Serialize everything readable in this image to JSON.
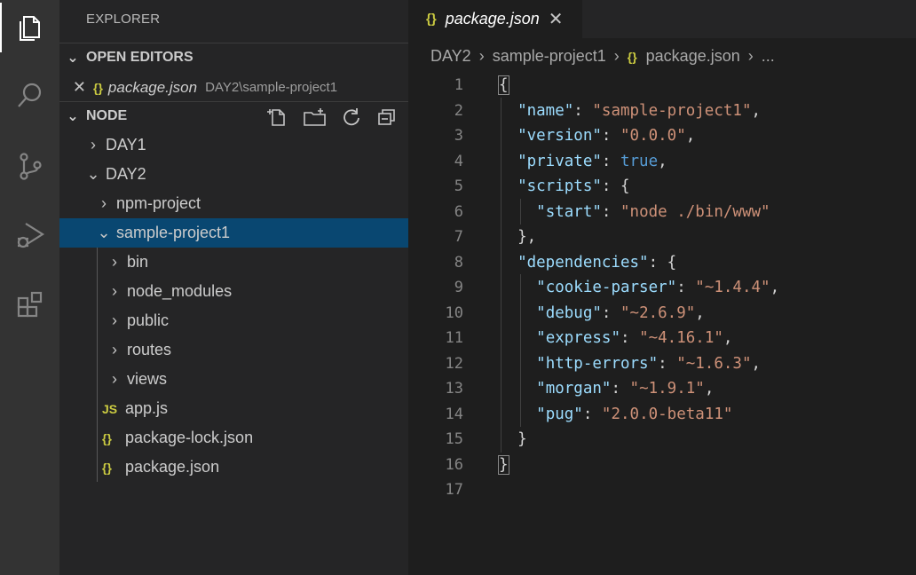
{
  "activity_bar": {
    "items": [
      {
        "name": "explorer",
        "icon": "files-icon",
        "active": true
      },
      {
        "name": "search",
        "icon": "search-icon"
      },
      {
        "name": "source-control",
        "icon": "source-control-icon"
      },
      {
        "name": "run-debug",
        "icon": "run-debug-icon"
      },
      {
        "name": "extensions",
        "icon": "extensions-icon"
      }
    ]
  },
  "sidebar": {
    "title": "EXPLORER",
    "open_editors": {
      "header": "OPEN EDITORS",
      "items": [
        {
          "close": "✕",
          "icon": "{}",
          "name": "package.json",
          "path": "DAY2\\sample-project1"
        }
      ]
    },
    "workspace": {
      "header": "NODE",
      "actions": [
        "new-file-icon",
        "new-folder-icon",
        "refresh-icon",
        "collapse-all-icon"
      ],
      "tree": [
        {
          "label": "DAY1",
          "chevron": "›",
          "depth": 0
        },
        {
          "label": "DAY2",
          "chevron": "⌄",
          "depth": 0
        },
        {
          "label": "npm-project",
          "chevron": "›",
          "depth": 1
        },
        {
          "label": "sample-project1",
          "chevron": "⌄",
          "depth": 1,
          "selected": true
        },
        {
          "label": "bin",
          "chevron": "›",
          "depth": 2
        },
        {
          "label": "node_modules",
          "chevron": "›",
          "depth": 2
        },
        {
          "label": "public",
          "chevron": "›",
          "depth": 2
        },
        {
          "label": "routes",
          "chevron": "›",
          "depth": 2
        },
        {
          "label": "views",
          "chevron": "›",
          "depth": 2
        },
        {
          "label": "app.js",
          "icon": "JS",
          "depth": 2
        },
        {
          "label": "package-lock.json",
          "icon": "{}",
          "depth": 2
        },
        {
          "label": "package.json",
          "icon": "{}",
          "depth": 2
        }
      ]
    }
  },
  "editor": {
    "tab": {
      "icon": "{}",
      "label": "package.json",
      "close": "✕"
    },
    "breadcrumbs": [
      "DAY2",
      "sample-project1",
      "package.json",
      "..."
    ],
    "breadcrumb_icon": "{}",
    "lines": [
      [
        [
          "p",
          "{"
        ]
      ],
      [
        [
          "p",
          "  "
        ],
        [
          "k",
          "\"name\""
        ],
        [
          "p",
          ": "
        ],
        [
          "s",
          "\"sample-project1\""
        ],
        [
          "p",
          ","
        ]
      ],
      [
        [
          "p",
          "  "
        ],
        [
          "k",
          "\"version\""
        ],
        [
          "p",
          ": "
        ],
        [
          "s",
          "\"0.0.0\""
        ],
        [
          "p",
          ","
        ]
      ],
      [
        [
          "p",
          "  "
        ],
        [
          "k",
          "\"private\""
        ],
        [
          "p",
          ": "
        ],
        [
          "b",
          "true"
        ],
        [
          "p",
          ","
        ]
      ],
      [
        [
          "p",
          "  "
        ],
        [
          "k",
          "\"scripts\""
        ],
        [
          "p",
          ": {"
        ]
      ],
      [
        [
          "p",
          "    "
        ],
        [
          "k",
          "\"start\""
        ],
        [
          "p",
          ": "
        ],
        [
          "s",
          "\"node ./bin/www\""
        ]
      ],
      [
        [
          "p",
          "  },"
        ]
      ],
      [
        [
          "p",
          "  "
        ],
        [
          "k",
          "\"dependencies\""
        ],
        [
          "p",
          ": {"
        ]
      ],
      [
        [
          "p",
          "    "
        ],
        [
          "k",
          "\"cookie-parser\""
        ],
        [
          "p",
          ": "
        ],
        [
          "s",
          "\"~1.4.4\""
        ],
        [
          "p",
          ","
        ]
      ],
      [
        [
          "p",
          "    "
        ],
        [
          "k",
          "\"debug\""
        ],
        [
          "p",
          ": "
        ],
        [
          "s",
          "\"~2.6.9\""
        ],
        [
          "p",
          ","
        ]
      ],
      [
        [
          "p",
          "    "
        ],
        [
          "k",
          "\"express\""
        ],
        [
          "p",
          ": "
        ],
        [
          "s",
          "\"~4.16.1\""
        ],
        [
          "p",
          ","
        ]
      ],
      [
        [
          "p",
          "    "
        ],
        [
          "k",
          "\"http-errors\""
        ],
        [
          "p",
          ": "
        ],
        [
          "s",
          "\"~1.6.3\""
        ],
        [
          "p",
          ","
        ]
      ],
      [
        [
          "p",
          "    "
        ],
        [
          "k",
          "\"morgan\""
        ],
        [
          "p",
          ": "
        ],
        [
          "s",
          "\"~1.9.1\""
        ],
        [
          "p",
          ","
        ]
      ],
      [
        [
          "p",
          "    "
        ],
        [
          "k",
          "\"pug\""
        ],
        [
          "p",
          ": "
        ],
        [
          "s",
          "\"2.0.0-beta11\""
        ]
      ],
      [
        [
          "p",
          "  }"
        ]
      ],
      [
        [
          "p",
          "}"
        ]
      ],
      []
    ]
  }
}
